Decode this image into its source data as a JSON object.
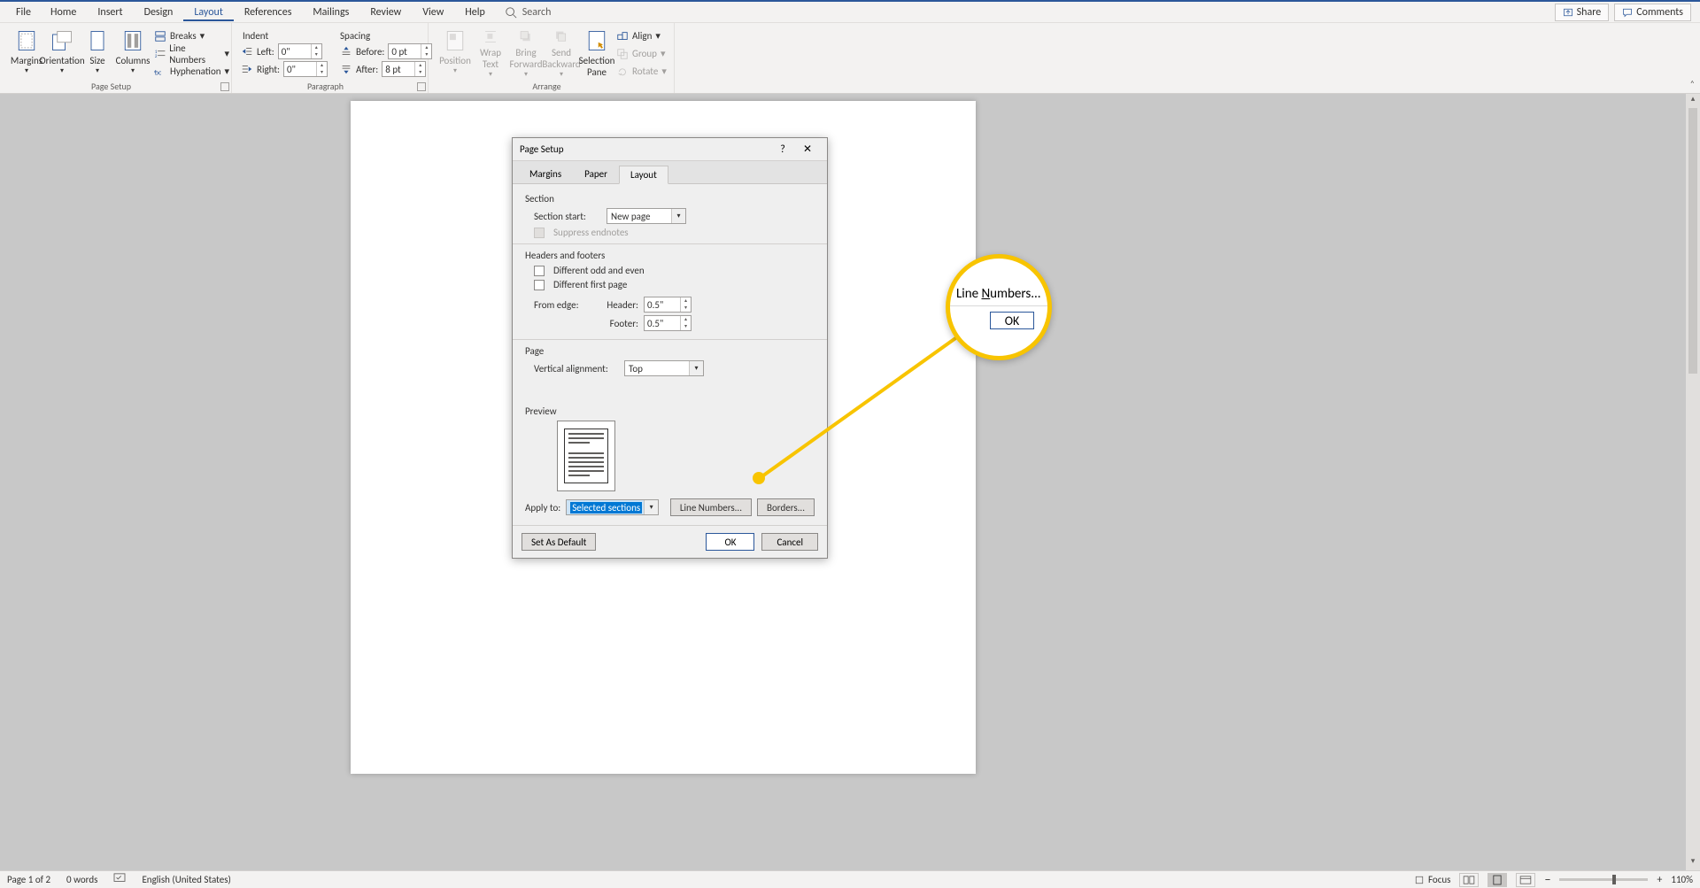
{
  "menu": {
    "tabs": [
      "File",
      "Home",
      "Insert",
      "Design",
      "Layout",
      "References",
      "Mailings",
      "Review",
      "View",
      "Help"
    ],
    "active": "Layout",
    "search_placeholder": "Search",
    "share": "Share",
    "comments": "Comments"
  },
  "ribbon": {
    "page_setup": {
      "label": "Page Setup",
      "margins": "Margins",
      "orientation": "Orientation",
      "size": "Size",
      "columns": "Columns",
      "breaks": "Breaks",
      "line_numbers": "Line Numbers",
      "hyphenation": "Hyphenation"
    },
    "paragraph": {
      "label": "Paragraph",
      "indent": "Indent",
      "spacing": "Spacing",
      "left_lbl": "Left:",
      "left_val": "0\"",
      "right_lbl": "Right:",
      "right_val": "0\"",
      "before_lbl": "Before:",
      "before_val": "0 pt",
      "after_lbl": "After:",
      "after_val": "8 pt"
    },
    "arrange": {
      "label": "Arrange",
      "position": "Position",
      "wrap": "Wrap\nText",
      "bring": "Bring\nForward",
      "send": "Send\nBackward",
      "selection": "Selection\nPane",
      "align": "Align",
      "group": "Group",
      "rotate": "Rotate"
    }
  },
  "dialog": {
    "title": "Page Setup",
    "tabs": [
      "Margins",
      "Paper",
      "Layout"
    ],
    "active_tab": "Layout",
    "section_h": "Section",
    "section_start_lbl": "Section start:",
    "section_start_val": "New page",
    "suppress": "Suppress endnotes",
    "hf_h": "Headers and footers",
    "diff_odd": "Different odd and even",
    "diff_first": "Different first page",
    "from_edge": "From edge:",
    "header_lbl": "Header:",
    "header_val": "0.5\"",
    "footer_lbl": "Footer:",
    "footer_val": "0.5\"",
    "page_h": "Page",
    "valign_lbl": "Vertical alignment:",
    "valign_val": "Top",
    "preview_h": "Preview",
    "apply_lbl": "Apply to:",
    "apply_val": "Selected sections",
    "line_numbers_btn": "Line Numbers...",
    "borders_btn": "Borders...",
    "default_btn": "Set As Default",
    "ok": "OK",
    "cancel": "Cancel"
  },
  "callout": {
    "text_before": "Line ",
    "text_under": "N",
    "text_after": "umbers...",
    "ok_fragment": "OK"
  },
  "status": {
    "page": "Page 1 of 2",
    "words": "0 words",
    "lang": "English (United States)",
    "focus": "Focus",
    "zoom_minus": "−",
    "zoom_plus": "+",
    "zoom": "110%"
  }
}
